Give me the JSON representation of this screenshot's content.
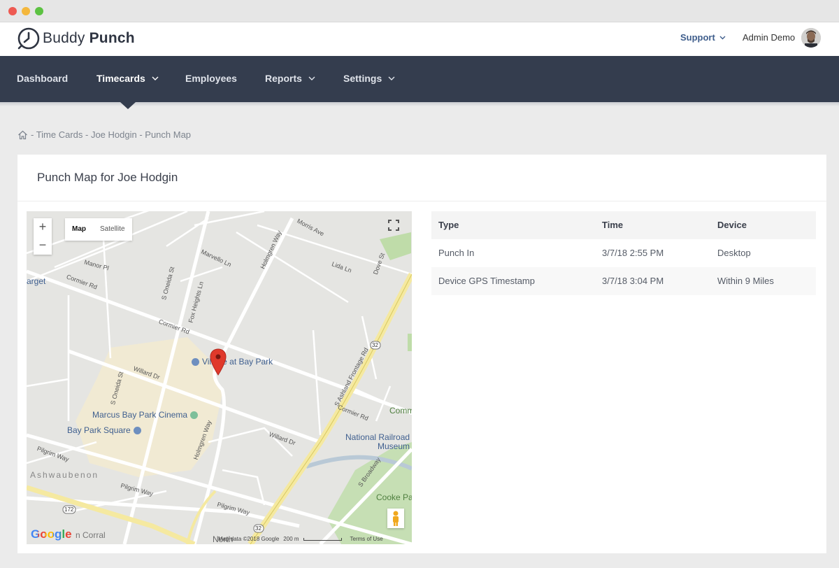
{
  "app": {
    "logo_word1": "Buddy",
    "logo_word2": "Punch",
    "support_label": "Support",
    "user_name": "Admin Demo"
  },
  "nav": {
    "items": [
      {
        "label": "Dashboard"
      },
      {
        "label": "Timecards"
      },
      {
        "label": "Employees"
      },
      {
        "label": "Reports"
      },
      {
        "label": "Settings"
      }
    ]
  },
  "breadcrumb": "- Time Cards - Joe Hodgin - Punch Map",
  "page": {
    "title": "Punch Map for Joe Hodgin"
  },
  "map": {
    "zoom_in": "+",
    "zoom_out": "−",
    "type_map": "Map",
    "type_satellite": "Satellite",
    "google_logo": "Google",
    "attribution": "Map data ©2018 Google",
    "scale": "200 m",
    "terms": "Terms of Use",
    "labels": {
      "morris_ave": "Morris Ave",
      "holmgren_way_n": "Holmgren Way",
      "marvello_ln": "Marvello Ln",
      "lida_ln": "Lida Ln",
      "dove_st": "Dove St",
      "cormier_rd_w": "Cormier Rd",
      "s_oneida_st_n": "S Oneida St",
      "fox_heights_ln": "Fox Heights Ln",
      "cormier_rd_c": "Cormier Rd",
      "manor_pl": "Manor Pl",
      "willard_dr_w": "Willard Dr",
      "s_oneida_st_s": "S Oneida St",
      "holmgren_way_s": "Holmgren Way",
      "willard_dr_e": "Willard Dr",
      "pilgrim_way_w": "Pilgrim Way",
      "pilgrim_way_c": "Pilgrim Way",
      "pilgrim_way_e": "Pilgrim Way",
      "ashwaubenon": "Ashwaubenon",
      "s_ashland": "S Ashland Frontage Rd",
      "cormier_rd_e": "Cormier Rd",
      "s_broadway": "S Broadway",
      "route_32a": "32",
      "route_32b": "32",
      "route_172": "172",
      "target": "arget",
      "north": "North",
      "corral": "n Corral",
      "cooke_park": "Cooke Pa",
      "comm": "Comm"
    },
    "pois": {
      "village": "Village at Bay Park",
      "cinema": "Marcus Bay Park Cinema",
      "square": "Bay Park Square",
      "museum_line1": "National Railroad",
      "museum_line2": "Museum"
    }
  },
  "table": {
    "headers": [
      "Type",
      "Time",
      "Device"
    ],
    "rows": [
      [
        "Punch In",
        "3/7/18 2:55 PM",
        "Desktop"
      ],
      [
        "Device GPS Timestamp",
        "3/7/18 3:04 PM",
        "Within 9 Miles"
      ]
    ]
  }
}
